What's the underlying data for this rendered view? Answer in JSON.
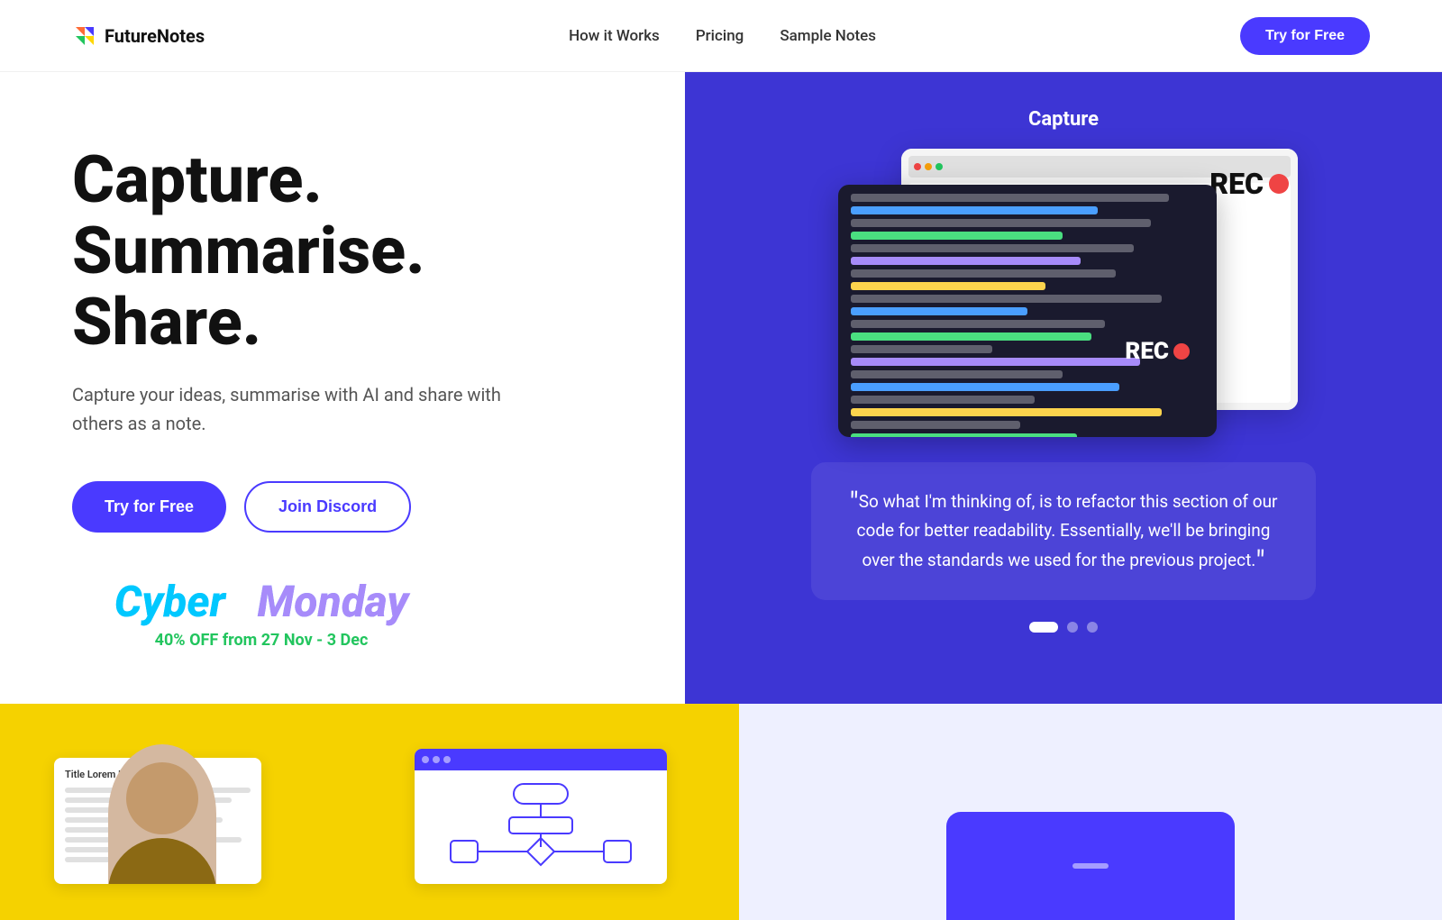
{
  "nav": {
    "logo_text": "FutureNotes",
    "links": [
      {
        "id": "how-it-works",
        "label": "How it Works"
      },
      {
        "id": "pricing",
        "label": "Pricing"
      },
      {
        "id": "sample-notes",
        "label": "Sample Notes"
      }
    ],
    "cta_label": "Try for Free"
  },
  "hero": {
    "headline_line1": "Capture.  Summarise.",
    "headline_line2": "Share.",
    "subtext": "Capture your ideas, summarise with AI and share with others as a note.",
    "btn_primary": "Try for Free",
    "btn_secondary": "Join Discord",
    "promo_cyber": "Cyber",
    "promo_monday": "Monday",
    "promo_discount": "40% OFF from 27 Nov - 3 Dec"
  },
  "right_panel": {
    "capture_label": "Capture",
    "quote": "So what I'm thinking of, is to refactor this section of our code for better readability. Essentially, we'll be bringing over the standards we used for the previous project.",
    "rec_label": "REC"
  }
}
